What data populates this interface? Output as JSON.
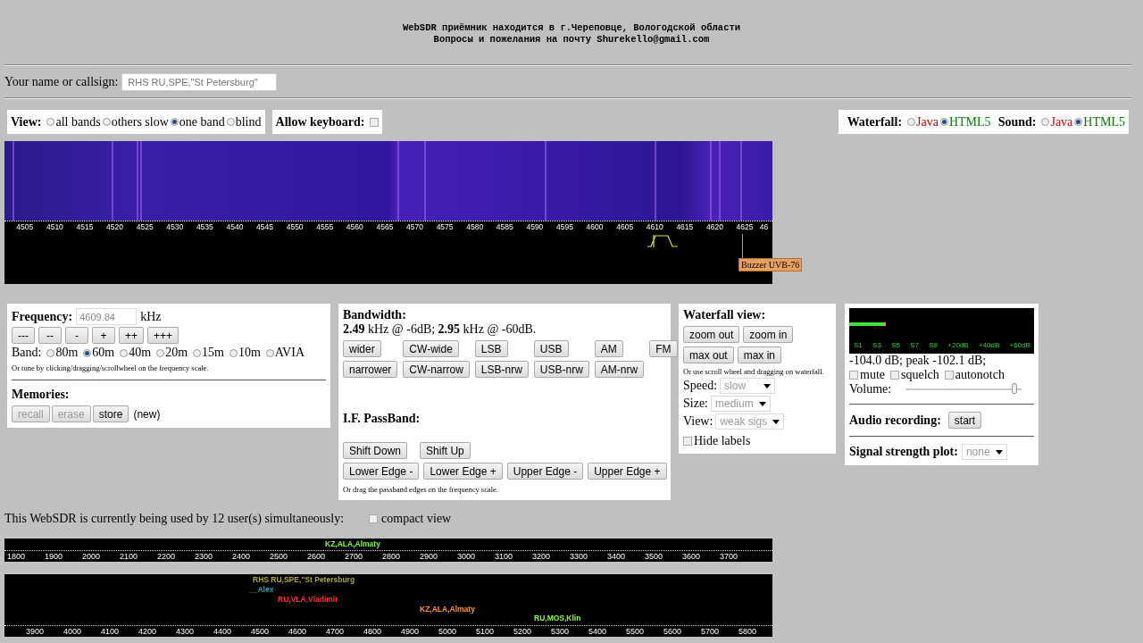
{
  "header": {
    "lines": [
      "WebSDR приёмник находится в г.Череповце, Вологодской области",
      "Вопросы и пожелания на почту Shurekello@gmail.com"
    ]
  },
  "callsign": {
    "label": "Your name or callsign:",
    "value": "RHS RU,SPE,\"St Petersburg\""
  },
  "view": {
    "label": "View:",
    "options": [
      {
        "label": "all bands",
        "selected": false
      },
      {
        "label": "others slow",
        "selected": false
      },
      {
        "label": "one band",
        "selected": true
      },
      {
        "label": "blind",
        "selected": false
      }
    ]
  },
  "keyboard": {
    "label": "Allow keyboard:",
    "checked": false
  },
  "render": [
    {
      "label": "Waterfall:",
      "options": [
        {
          "label": "Java",
          "selected": false,
          "color": "#cc0000"
        },
        {
          "label": "HTML5",
          "selected": true,
          "color": "#008000"
        }
      ]
    },
    {
      "label": "Sound:",
      "options": [
        {
          "label": "Java",
          "selected": false,
          "color": "#cc0000"
        },
        {
          "label": "HTML5",
          "selected": true,
          "color": "#008000"
        }
      ]
    }
  ],
  "waterfall": {
    "scale_labels": [
      "4505",
      "4510",
      "4515",
      "4520",
      "4525",
      "4530",
      "4535",
      "4540",
      "4545",
      "4550",
      "4555",
      "4560",
      "4565",
      "4570",
      "4575",
      "4580",
      "4585",
      "4590",
      "4595",
      "4600",
      "4605",
      "4610",
      "4615",
      "4620",
      "4625",
      "46"
    ],
    "markers": [
      {
        "label": "Buzzer UVB-76"
      }
    ]
  },
  "frequency": {
    "label": "Frequency:",
    "value": "4609.84",
    "unit": "kHz",
    "steps": [
      "---",
      "--",
      "-",
      "+",
      "++",
      "+++"
    ],
    "band_label": "Band:",
    "bands": [
      {
        "label": "80m",
        "selected": false
      },
      {
        "label": "60m",
        "selected": true
      },
      {
        "label": "40m",
        "selected": false
      },
      {
        "label": "20m",
        "selected": false
      },
      {
        "label": "15m",
        "selected": false
      },
      {
        "label": "10m",
        "selected": false
      },
      {
        "label": "AVIA",
        "selected": false
      }
    ],
    "hint": "Or tune by clicking/dragging/scrollwheel on the frequency scale.",
    "memories_title": "Memories:",
    "memory_buttons": [
      {
        "label": "recall",
        "disabled": true
      },
      {
        "label": "erase",
        "disabled": true
      },
      {
        "label": "store",
        "disabled": false
      }
    ],
    "memory_note": "(new)"
  },
  "bandwidth": {
    "title": "Bandwidth:",
    "reading": "**2.49** kHz @ -6dB; **2.95** kHz @ -60dB.",
    "buttons": [
      "wider",
      "CW-wide",
      "LSB",
      "USB",
      "AM",
      "FM",
      "narrower",
      "CW-narrow",
      "LSB-nrw",
      "USB-nrw",
      "AM-nrw"
    ],
    "passband_title": "I.F. PassBand:",
    "shift_buttons": [
      "Shift Down",
      "Shift Up"
    ],
    "edge_buttons": [
      "Lower Edge -",
      "Lower Edge +",
      "Upper Edge -",
      "Upper Edge +"
    ],
    "hint": "Or drag the passband edges on the frequency scale."
  },
  "waterfall_view": {
    "title": "Waterfall view:",
    "buttons": [
      [
        "zoom out",
        "zoom in"
      ],
      [
        "max out",
        "max in"
      ]
    ],
    "hint": "Or use scroll wheel and dragging on waterfall.",
    "selects": [
      {
        "label": "Speed:",
        "value": "slow"
      },
      {
        "label": "Size:",
        "value": "medium"
      },
      {
        "label": "View:",
        "value": "weak sigs"
      }
    ],
    "hide_labels": {
      "label": "Hide labels",
      "checked": false
    }
  },
  "audio": {
    "smeter": {
      "level": 0.2,
      "scale": [
        "S1",
        "S3",
        "S5",
        "S7",
        "S9",
        "+20dB",
        "+40dB",
        "+60dB"
      ]
    },
    "reading": "-104.0 dB; peak -102.1 dB;",
    "checkboxes": [
      {
        "label": "mute",
        "checked": false
      },
      {
        "label": "squelch",
        "checked": false
      },
      {
        "label": "autonotch",
        "checked": false
      }
    ],
    "volume": {
      "label": "Volume:",
      "level": 0.94
    },
    "recording": {
      "label": "Audio recording:",
      "button": "start"
    },
    "plot": {
      "label": "Signal strength plot:",
      "value": "none"
    }
  },
  "users": {
    "text": "This WebSDR is currently being used by 12 user(s) simultaneously:",
    "compact": {
      "label": "compact view",
      "checked": false
    }
  },
  "strips": [
    {
      "ticks": [
        "1800",
        "1900",
        "2000",
        "2100",
        "2200",
        "2300",
        "2400",
        "2500",
        "2600",
        "2700",
        "2800",
        "2900",
        "3000",
        "3100",
        "3200",
        "3300",
        "3400",
        "3500",
        "3600",
        "3700"
      ],
      "users": [
        {
          "name": "KZ,ALA,Almaty",
          "color": "#80ff30"
        }
      ]
    },
    {
      "ticks": [
        "3900",
        "4000",
        "4100",
        "4200",
        "4300",
        "4400",
        "4500",
        "4600",
        "4700",
        "4800",
        "4900",
        "5000",
        "5100",
        "5200",
        "5300",
        "5400",
        "5500",
        "5600",
        "5700",
        "5800"
      ],
      "users": [
        {
          "name": "RHS RU,SPE,\"St Petersburg",
          "color": "#a8a838"
        },
        {
          "name": "__Alex",
          "color": "#20a0a8"
        },
        {
          "name": "RU,VLA,Vladimir",
          "color": "#ff3030"
        },
        {
          "name": "KZ,ALA,Almaty",
          "color": "#ff9820"
        },
        {
          "name": "RU,MOS,Klin",
          "color": "#80ff30"
        }
      ]
    }
  ]
}
